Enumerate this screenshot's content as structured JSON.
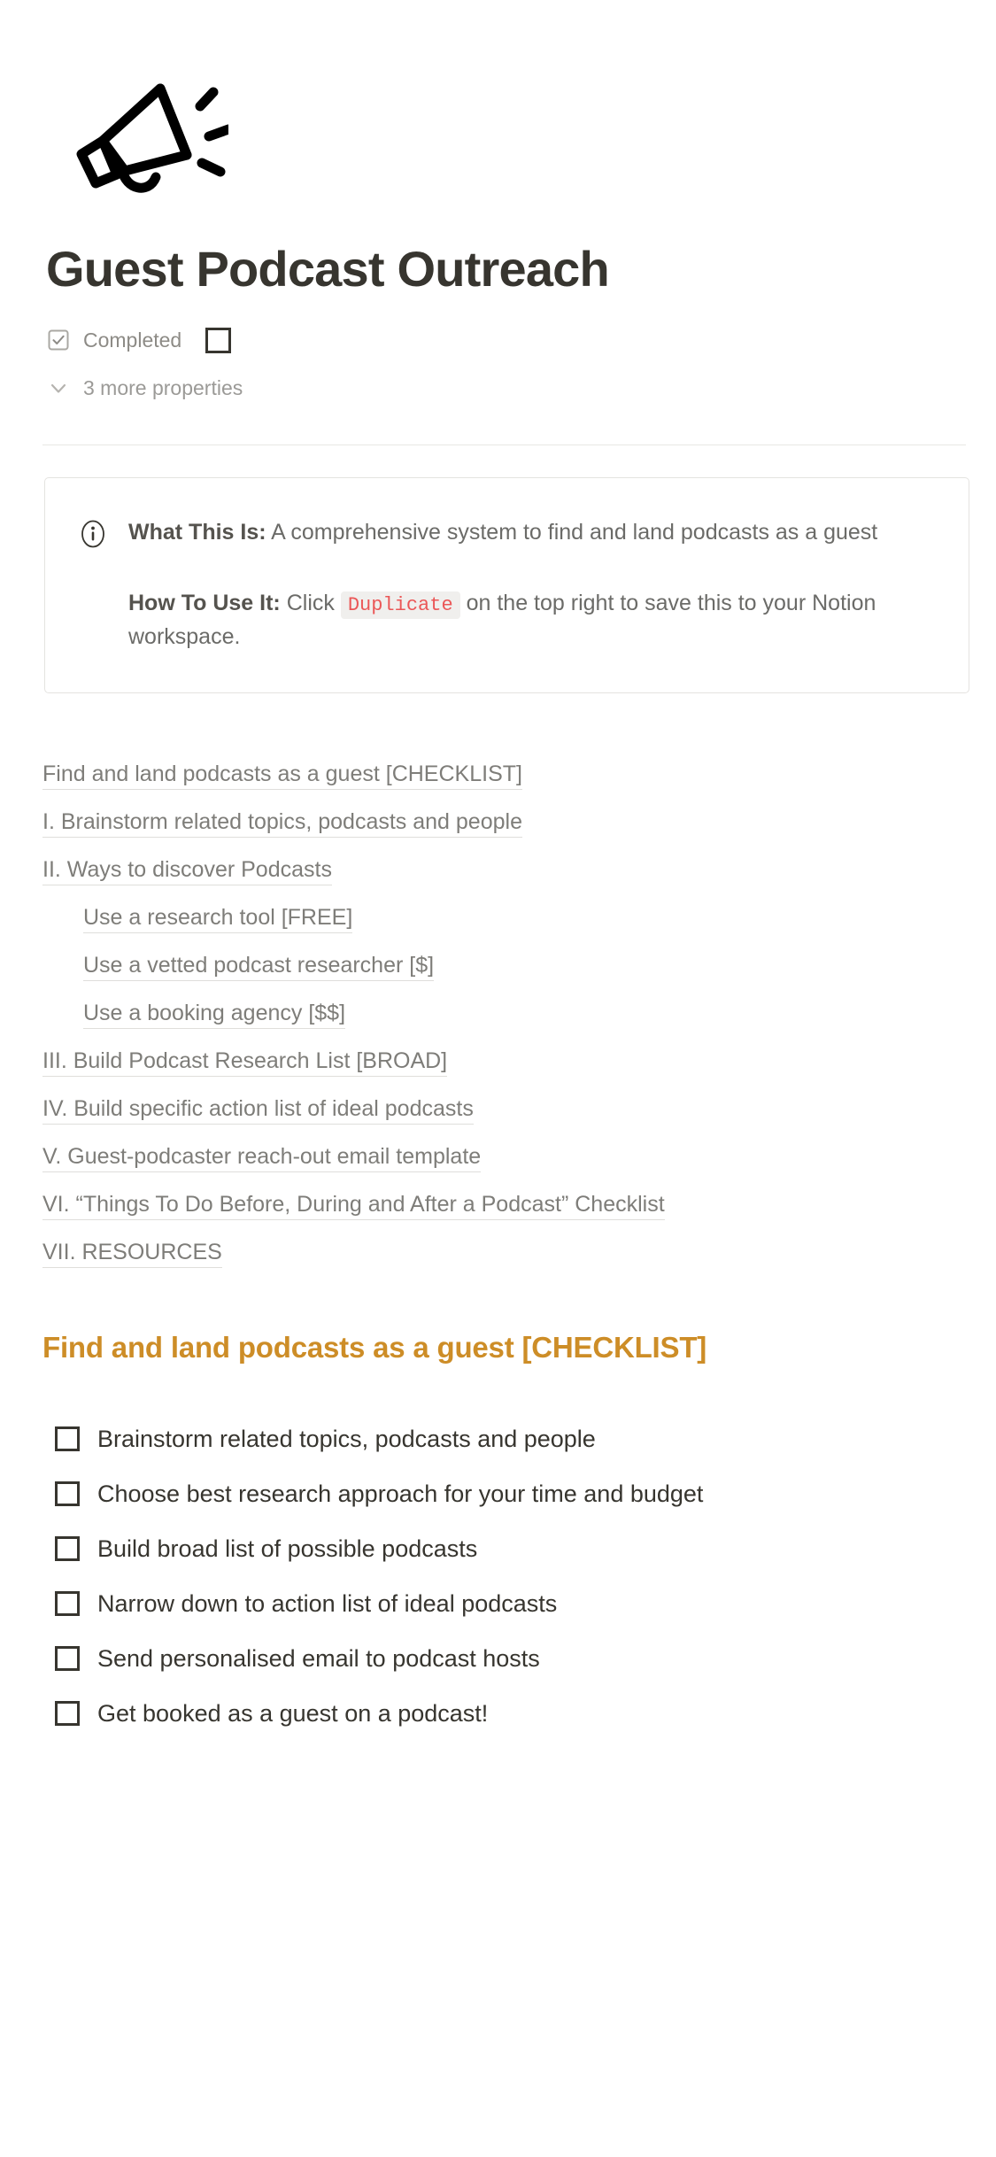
{
  "page": {
    "icon": "megaphone-icon",
    "title": "Guest Podcast Outreach"
  },
  "properties": {
    "rows": [
      {
        "icon": "checkbox-checked-icon",
        "label": "Completed",
        "value_type": "checkbox",
        "checked": false
      }
    ],
    "more_properties_label": "3 more properties",
    "more_properties_icon": "chevron-down-icon"
  },
  "callout": {
    "icon": "info-circle-icon",
    "paragraphs": [
      {
        "lead": "What This Is:",
        "text": " A comprehensive system to find and land podcasts as a guest"
      },
      {
        "lead": "How To Use It:",
        "text_before": " Click ",
        "code": "Duplicate",
        "text_after": " on the top right to save this to your Notion workspace."
      }
    ]
  },
  "table_of_contents": [
    {
      "label": "Find and land podcasts as a guest [CHECKLIST]",
      "indent": 0
    },
    {
      "label": "I. Brainstorm related topics, podcasts and people",
      "indent": 0
    },
    {
      "label": "II. Ways to discover Podcasts",
      "indent": 0
    },
    {
      "label": "Use a research tool [FREE]",
      "indent": 1
    },
    {
      "label": "Use a vetted podcast researcher [$]",
      "indent": 1
    },
    {
      "label": "Use a booking agency [$$]",
      "indent": 1
    },
    {
      "label": "III. Build Podcast Research List [BROAD]",
      "indent": 0
    },
    {
      "label": "IV. Build specific action list of ideal podcasts",
      "indent": 0
    },
    {
      "label": "V. Guest-podcaster reach-out email template",
      "indent": 0
    },
    {
      "label": "VI. “Things To Do Before, During and After a Podcast” Checklist",
      "indent": 0
    },
    {
      "label": "VII. RESOURCES",
      "indent": 0
    }
  ],
  "section": {
    "heading": "Find and land podcasts as a guest [CHECKLIST]",
    "heading_color": "#cd8d27"
  },
  "checklist": [
    {
      "label": "Brainstorm related topics, podcasts and people",
      "checked": false
    },
    {
      "label": "Choose best research approach for your time and budget",
      "checked": false
    },
    {
      "label": "Build broad list of possible podcasts",
      "checked": false
    },
    {
      "label": "Narrow down to action list of ideal podcasts",
      "checked": false
    },
    {
      "label": "Send personalised email to podcast hosts",
      "checked": false
    },
    {
      "label": "Get booked as a guest on a podcast!",
      "checked": false
    }
  ],
  "colors": {
    "text": "#37352f",
    "muted": "#7e7d79",
    "accent_orange": "#cd8d27",
    "code_red": "#eb5757",
    "border": "#e4e3e0"
  }
}
